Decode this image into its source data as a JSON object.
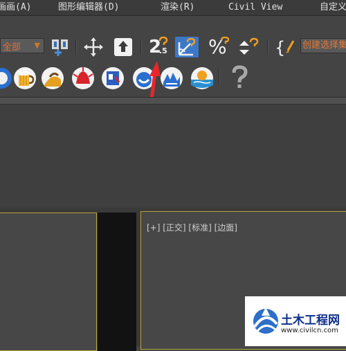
{
  "menubar": {
    "items": [
      {
        "label": "画画(A)"
      },
      {
        "label": "图形编辑器(D)"
      },
      {
        "label": "渲染(R)"
      },
      {
        "label": "Civil View"
      },
      {
        "label": "自定义"
      }
    ]
  },
  "toolbar": {
    "selection_filter_value": "全部",
    "snap_25_label": "2",
    "snap_25_sub": ".5",
    "percent_snap_label": "%",
    "named_selection_placeholder": "创建选择集"
  },
  "viewport_right": {
    "label": "[+] [正交] [标准] [边面]"
  },
  "watermark": {
    "name": "土木工程网",
    "url": "www.civilcn.com"
  },
  "colors": {
    "accent_orange": "#e07a3a",
    "viewport_border": "#b8a53a",
    "highlight_blue": "#3c78c8",
    "arrow_red": "#e8262b"
  }
}
